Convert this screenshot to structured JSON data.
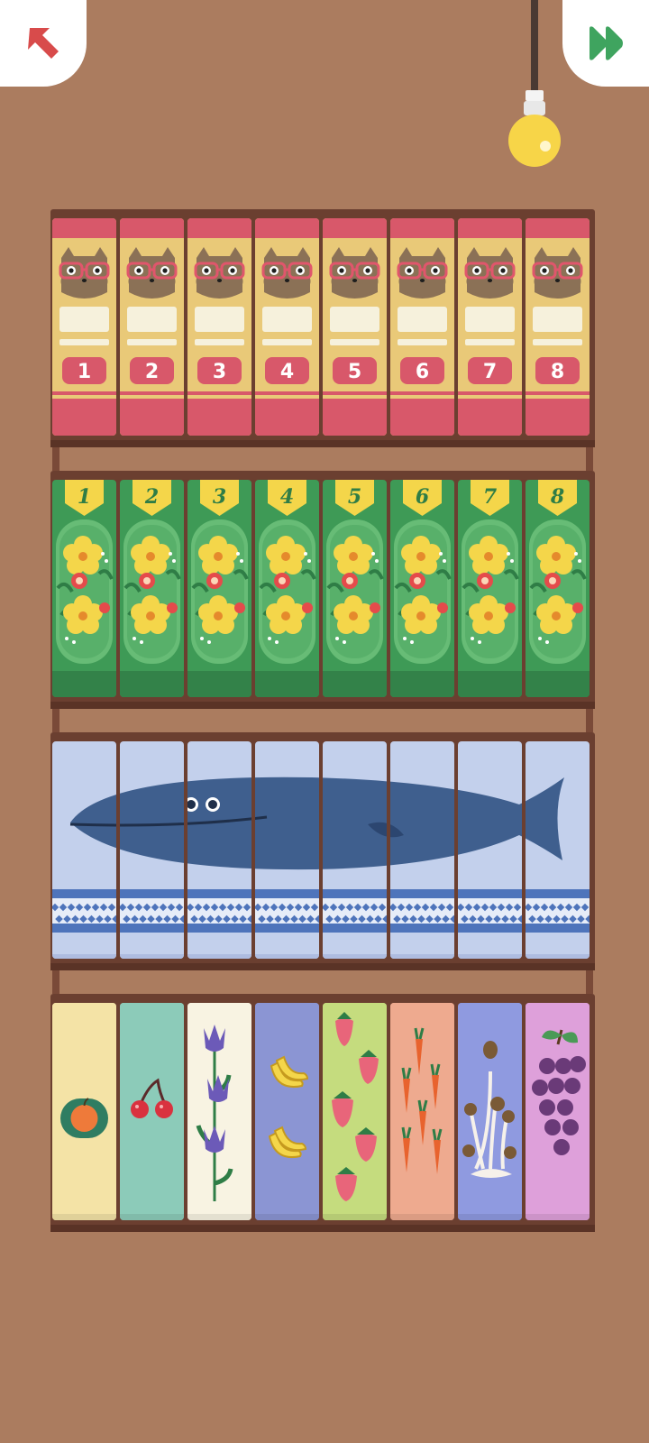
{
  "top_bar": {
    "back_icon": "arrow-up-left-icon",
    "skip_icon": "fast-forward-icon",
    "hint_icon": "light-bulb-icon",
    "colors": {
      "back": "#d84b4b",
      "skip": "#3fa45f",
      "bulb": "#f7d548"
    }
  },
  "shelves": [
    {
      "theme": "raccoon-notebooks",
      "books": [
        {
          "label": "1"
        },
        {
          "label": "2"
        },
        {
          "label": "3"
        },
        {
          "label": "4"
        },
        {
          "label": "5"
        },
        {
          "label": "6"
        },
        {
          "label": "7"
        },
        {
          "label": "8"
        }
      ]
    },
    {
      "theme": "flower-books",
      "books": [
        {
          "label": "1"
        },
        {
          "label": "2"
        },
        {
          "label": "3"
        },
        {
          "label": "4"
        },
        {
          "label": "5"
        },
        {
          "label": "6"
        },
        {
          "label": "7"
        },
        {
          "label": "8"
        }
      ]
    },
    {
      "theme": "whale-puzzle",
      "books": [
        {
          "piece": "whale-head"
        },
        {
          "piece": "whale-eye"
        },
        {
          "piece": "whale-mouth"
        },
        {
          "piece": "whale-body"
        },
        {
          "piece": "whale-body"
        },
        {
          "piece": "whale-fin"
        },
        {
          "piece": "whale-body"
        },
        {
          "piece": "whale-tail"
        }
      ]
    },
    {
      "theme": "fruit-veg-books",
      "books": [
        {
          "icon": "orange-icon",
          "color": "#f4e3a6"
        },
        {
          "icon": "cherry-icon",
          "color": "#8ccbb9"
        },
        {
          "icon": "tulip-icon",
          "color": "#f8f3e2"
        },
        {
          "icon": "banana-icon",
          "color": "#8b95d3"
        },
        {
          "icon": "strawberry-icon",
          "color": "#c5dc7e"
        },
        {
          "icon": "carrot-icon",
          "color": "#eeaa8f"
        },
        {
          "icon": "mushroom-icon",
          "color": "#8f9ae0"
        },
        {
          "icon": "grape-icon",
          "color": "#dea0da"
        }
      ]
    }
  ]
}
